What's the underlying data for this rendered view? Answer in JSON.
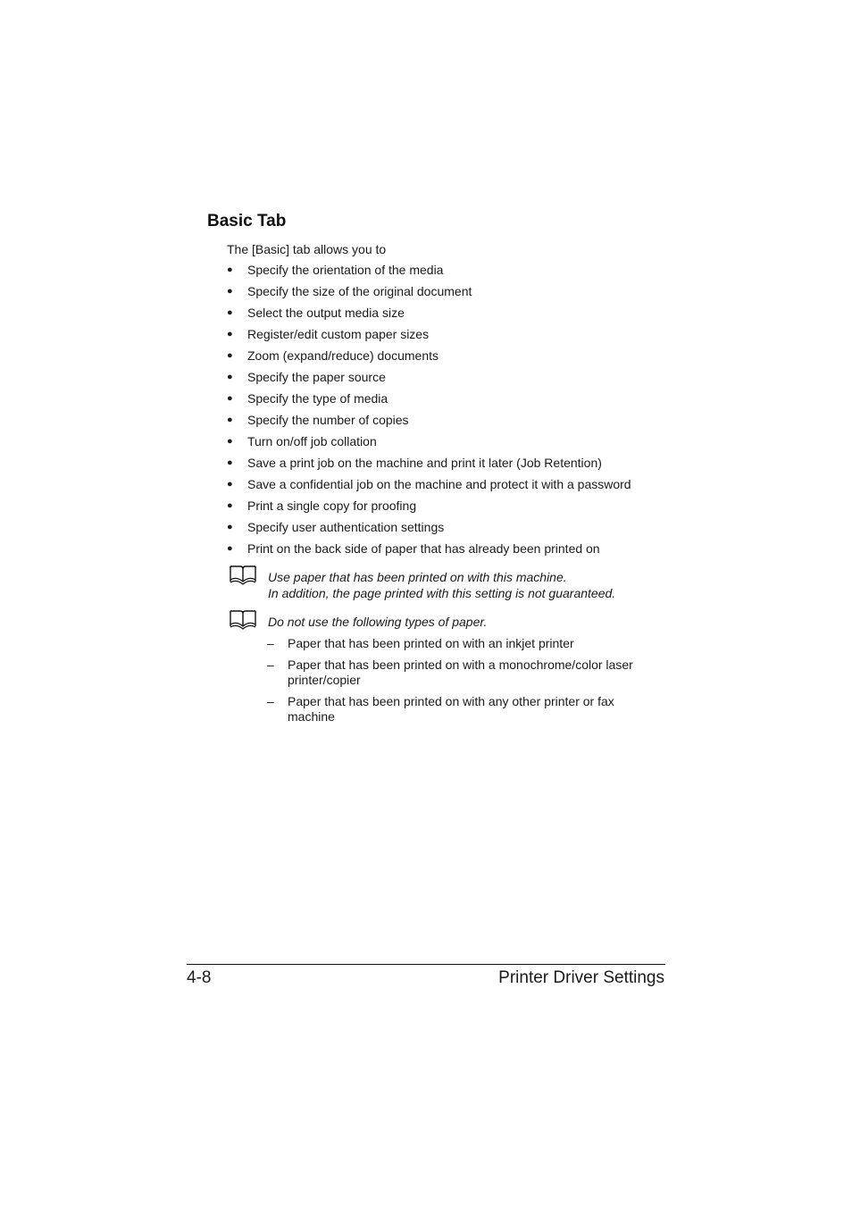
{
  "heading": "Basic Tab",
  "intro": "The [Basic] tab allows you to",
  "bullets": [
    "Specify the orientation of the media",
    "Specify the size of the original document",
    "Select the output media size",
    "Register/edit custom paper sizes",
    "Zoom (expand/reduce) documents",
    "Specify the paper source",
    "Specify the type of media",
    "Specify the number of copies",
    "Turn on/off job collation",
    "Save a print job on the machine and print it later (Job Retention)",
    "Save a confidential job on the machine and protect it with a password",
    "Print a single copy for proofing",
    "Specify user authentication settings",
    "Print on the back side of paper that has already been printed on"
  ],
  "bullet_glyph": "●",
  "notes": [
    {
      "icon": "book-icon",
      "lines": [
        "Use paper that has been printed on with this machine.",
        "In addition, the page printed with this setting is not guaranteed."
      ]
    },
    {
      "icon": "book-icon",
      "lines": [
        "Do not use the following types of paper."
      ]
    }
  ],
  "dash_glyph": "–",
  "paper_types": [
    "Paper that has been printed on with an inkjet printer",
    "Paper that has been printed on with a monochrome/color laser printer/copier",
    "Paper that has been printed on with any other printer or fax machine"
  ],
  "footer": {
    "page_number": "4-8",
    "section": "Printer Driver Settings"
  }
}
